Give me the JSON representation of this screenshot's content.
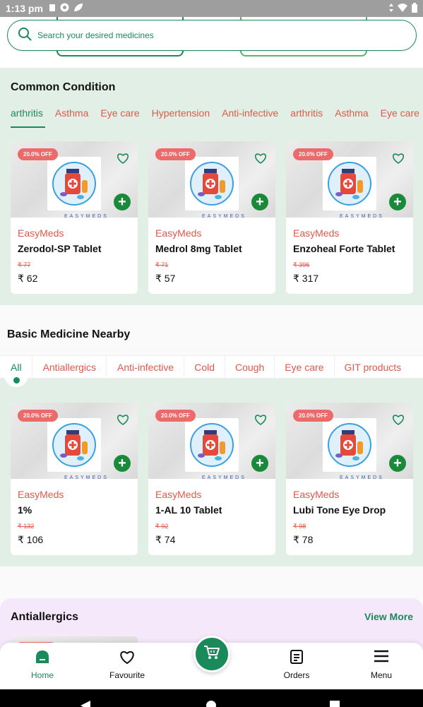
{
  "status_bar": {
    "time": "1:13 pm"
  },
  "search": {
    "placeholder": "Search your desired medicines"
  },
  "common_condition": {
    "title": "Common Condition",
    "tabs": [
      "arthritis",
      "Asthma",
      "Eye care",
      "Hypertension",
      "Anti-infective",
      "arthritis",
      "Asthma",
      "Eye care"
    ],
    "products": [
      {
        "badge": "20.0% OFF",
        "seller": "EasyMeds",
        "name": "Zerodol-SP Tablet",
        "old_price": "₹ 77",
        "price": "₹ 62"
      },
      {
        "badge": "20.0% OFF",
        "seller": "EasyMeds",
        "name": "Medrol 8mg Tablet",
        "old_price": "₹ 71",
        "price": "₹ 57"
      },
      {
        "badge": "20.0% OFF",
        "seller": "EasyMeds",
        "name": "Enzoheal Forte Tablet",
        "old_price": "₹ 396",
        "price": "₹ 317"
      }
    ]
  },
  "basic_medicine": {
    "title": "Basic Medicine Nearby",
    "tabs": [
      "All",
      "Antiallergics",
      "Anti-infective",
      "Cold",
      "Cough",
      "Eye care",
      "GIT products"
    ],
    "products": [
      {
        "badge": "20.0% OFF",
        "seller": "EasyMeds",
        "name": "1%",
        "old_price": "₹ 132",
        "price": "₹ 106"
      },
      {
        "badge": "20.0% OFF",
        "seller": "EasyMeds",
        "name": "1-AL 10 Tablet",
        "old_price": "₹ 92",
        "price": "₹ 74"
      },
      {
        "badge": "20.0% OFF",
        "seller": "EasyMeds",
        "name": "Lubi Tone Eye Drop",
        "old_price": "₹ 98",
        "price": "₹ 78"
      }
    ]
  },
  "antiallergics": {
    "title": "Antiallergics",
    "view_more": "View More"
  },
  "brand_watermark": "EASYMEDS",
  "bottom_nav": {
    "home": "Home",
    "favourite": "Favourite",
    "orders": "Orders",
    "menu": "Menu"
  },
  "colors": {
    "primary_green": "#1a8a5a",
    "accent_red": "#e0584a",
    "section_bg": "#e2efe6",
    "badge_bg": "#ec6a6a"
  }
}
